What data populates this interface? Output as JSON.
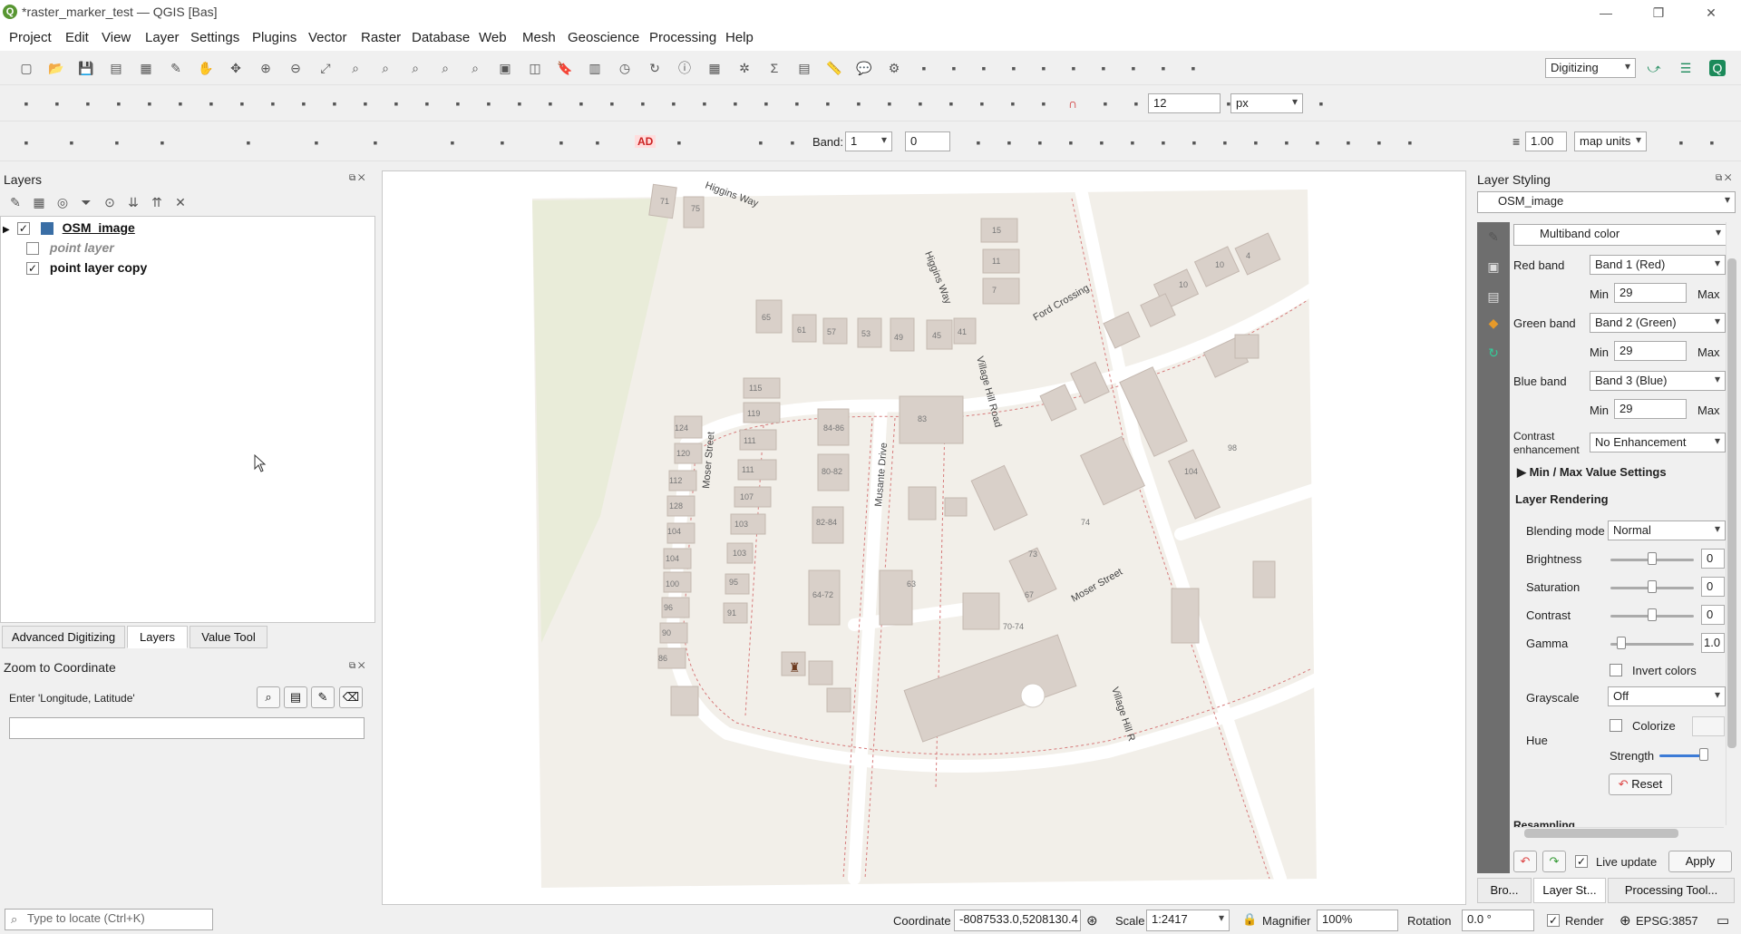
{
  "window": {
    "title": "*raster_marker_test — QGIS [Bas]",
    "minimize": "—",
    "restore": "❐",
    "close": "✕"
  },
  "menubar": [
    "Project",
    "Edit",
    "View",
    "Layer",
    "Settings",
    "Plugins",
    "Vector",
    "Raster",
    "Database",
    "Web",
    "Mesh",
    "Geoscience",
    "Processing",
    "Help"
  ],
  "toolbar": {
    "profile": "Digitizing",
    "snap_tolerance": "12",
    "snap_units": "px",
    "band_label": "Band:",
    "band_value": "1",
    "band_offset": "0",
    "label_ad": "AD",
    "stroke_width": "1.00",
    "stroke_units": "map units"
  },
  "layers_panel": {
    "title": "Layers",
    "layers": [
      {
        "name": "OSM_image",
        "checked": true
      },
      {
        "name": "point layer",
        "checked": false
      },
      {
        "name": "point layer copy",
        "checked": true
      }
    ],
    "tabs": [
      "Advanced Digitizing",
      "Layers",
      "Value Tool"
    ]
  },
  "zoom_panel": {
    "title": "Zoom to Coordinate",
    "prompt": "Enter 'Longitude, Latitude'"
  },
  "map_labels": {
    "higgins_way": "Higgins Way",
    "higgins_way_2": "Higgins Way",
    "ford_crossing": "Ford Crossing",
    "village_hill_road": "Village Hill Road",
    "village_hill_road_2": "Village Hill R",
    "moser_street_w": "Moser Street",
    "moser_street_e": "Moser Street",
    "musante_drive": "Musante Drive",
    "house_numbers": [
      "71",
      "75",
      "15",
      "11",
      "7",
      "65",
      "61",
      "57",
      "53",
      "49",
      "45",
      "41",
      "10",
      "10",
      "4",
      "124",
      "120",
      "112",
      "128",
      "104",
      "104",
      "100",
      "96",
      "90",
      "86",
      "115",
      "119",
      "111",
      "111",
      "107",
      "103",
      "103",
      "95",
      "91",
      "84-86",
      "80-82",
      "82-84",
      "64-72",
      "63",
      "83",
      "104",
      "98",
      "73",
      "74",
      "67",
      "70-74",
      "51-55A-H"
    ]
  },
  "styling": {
    "title": "Layer Styling",
    "layer": "OSM_image",
    "renderer": "Multiband color",
    "red_band_label": "Red band",
    "red_band": "Band 1 (Red)",
    "green_band_label": "Green band",
    "green_band": "Band 2 (Green)",
    "blue_band_label": "Blue band",
    "blue_band": "Band 3 (Blue)",
    "min_label": "Min",
    "max_label": "Max",
    "red_min": "29",
    "green_min": "29",
    "blue_min": "29",
    "contrast_label": "Contrast\nenhancement",
    "contrast_value": "No Enhancement",
    "minmax_header": "Min / Max Value Settings",
    "rendering_header": "Layer Rendering",
    "blending_label": "Blending mode",
    "blending_value": "Normal",
    "brightness_label": "Brightness",
    "brightness_value": "0",
    "saturation_label": "Saturation",
    "saturation_value": "0",
    "contrast2_label": "Contrast",
    "contrast2_value": "0",
    "gamma_label": "Gamma",
    "gamma_value": "1.0",
    "invert_label": "Invert colors",
    "grayscale_label": "Grayscale",
    "grayscale_value": "Off",
    "hue_label": "Hue",
    "colorize_label": "Colorize",
    "strength_label": "Strength",
    "reset_label": "Reset",
    "resampling_label": "Resampling",
    "live_update_label": "Live update",
    "apply_label": "Apply",
    "bottom_tabs": [
      "Bro...",
      "Layer St...",
      "Processing Tool..."
    ]
  },
  "statusbar": {
    "locate_placeholder": "Type to locate (Ctrl+K)",
    "coordinate_label": "Coordinate",
    "coordinate_value": "-8087533.0,5208130.4",
    "scale_label": "Scale",
    "scale_value": "1:2417",
    "magnifier_label": "Magnifier",
    "magnifier_value": "100%",
    "rotation_label": "Rotation",
    "rotation_value": "0.0 °",
    "render_label": "Render",
    "crs": "EPSG:3857"
  }
}
